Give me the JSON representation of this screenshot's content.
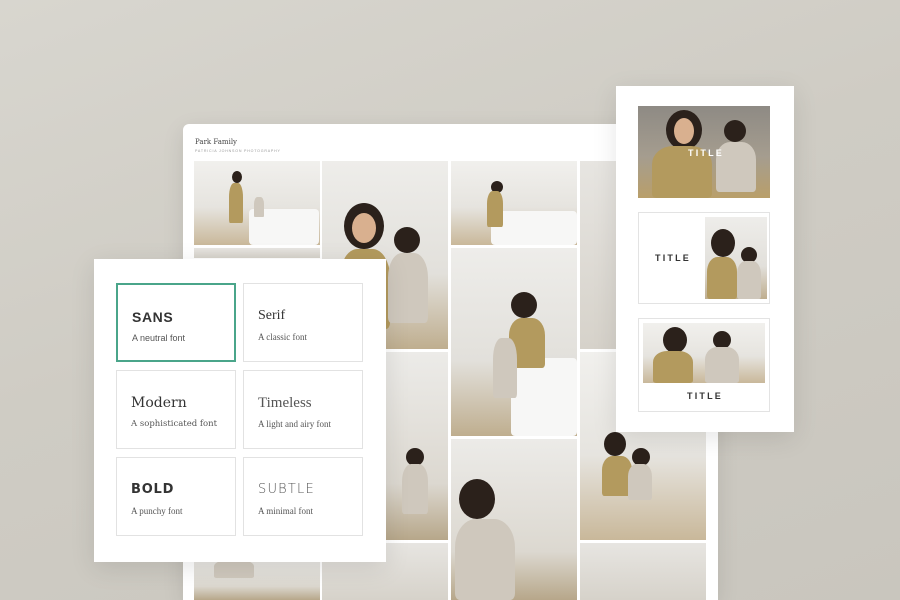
{
  "gallery": {
    "title": "Park Family",
    "subtitle": "PATRICIA JOHNSON PHOTOGRAPHY"
  },
  "font_options": [
    {
      "name": "SANS",
      "description": "A neutral font",
      "selected": true
    },
    {
      "name": "Serif",
      "description": "A classic font",
      "selected": false
    },
    {
      "name": "Modern",
      "description": "A sophisticated font",
      "selected": false
    },
    {
      "name": "Timeless",
      "description": "A light and airy font",
      "selected": false
    },
    {
      "name": "BOLD",
      "description": "A punchy font",
      "selected": false
    },
    {
      "name": "SUBTLE",
      "description": "A minimal font",
      "selected": false
    }
  ],
  "title_layouts": [
    {
      "label": "TITLE",
      "style": "overlay"
    },
    {
      "label": "TITLE",
      "style": "left-text"
    },
    {
      "label": "TITLE",
      "style": "below-text"
    }
  ],
  "colors": {
    "accent": "#4aa58a",
    "background": "#d2cfc8",
    "panel": "#ffffff"
  }
}
